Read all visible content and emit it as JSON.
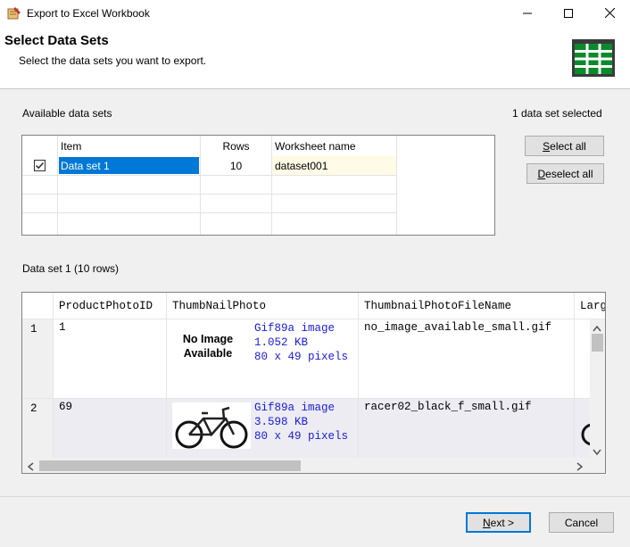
{
  "window": {
    "title": "Export to Excel Workbook",
    "minimize_icon": "minimize-icon",
    "maximize_icon": "maximize-icon",
    "close_icon": "close-icon"
  },
  "header": {
    "title": "Select Data Sets",
    "subtitle": "Select the data sets you want to export.",
    "icon": "excel-grid-icon",
    "icon_color": "#0a8a2a"
  },
  "available": {
    "label": "Available data sets",
    "selected_count": "1 data set selected",
    "columns": [
      "Item",
      "Rows",
      "Worksheet name"
    ],
    "rows": [
      {
        "checked": true,
        "item": "Data set 1",
        "rows": "10",
        "worksheet": "dataset001"
      }
    ],
    "select_all_prefix": "S",
    "select_all_rest": "elect all",
    "deselect_all_prefix": "D",
    "deselect_all_rest": "eselect all"
  },
  "preview": {
    "label": "Data set 1 (10 rows)",
    "columns": [
      "ProductPhotoID",
      "ThumbNailPhoto",
      "ThumbnailPhotoFileName",
      "Larg"
    ],
    "rows": [
      {
        "num": "1",
        "id": "1",
        "image_text_line1": "No Image",
        "image_text_line2": "Available",
        "img_type": "Gif89a image",
        "img_size": "1.052 KB",
        "img_dims": "80 x 49 pixels",
        "filename": "no_image_available_small.gif"
      },
      {
        "num": "2",
        "id": "69",
        "image": "bicycle-icon",
        "img_type": "Gif89a image",
        "img_size": "3.598 KB",
        "img_dims": "80 x 49 pixels",
        "filename": "racer02_black_f_small.gif"
      }
    ]
  },
  "footer": {
    "next_prefix": "N",
    "next_rest": "ext >",
    "cancel": "Cancel"
  },
  "colors": {
    "selection": "#0078d7",
    "worksheet_bg": "#fffbe6",
    "link_blue": "#1a1adc"
  }
}
